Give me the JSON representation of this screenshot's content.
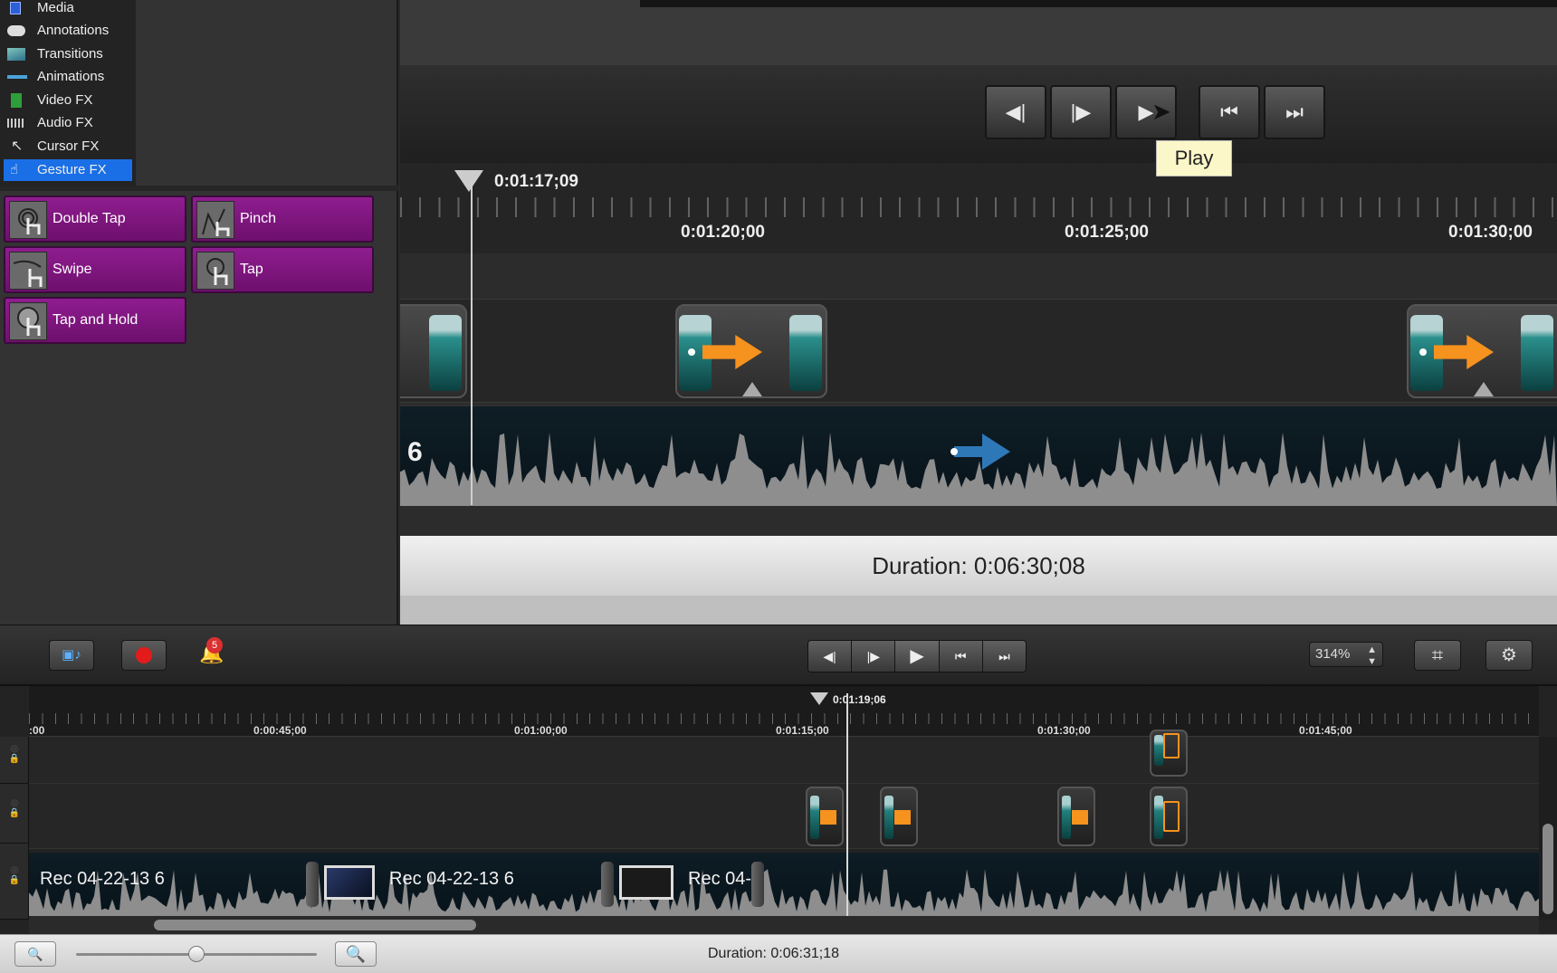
{
  "library": {
    "categories": [
      {
        "label": "Media",
        "icon": "media-icon"
      },
      {
        "label": "Annotations",
        "icon": "annotations-icon"
      },
      {
        "label": "Transitions",
        "icon": "transitions-icon"
      },
      {
        "label": "Animations",
        "icon": "animations-icon"
      },
      {
        "label": "Video FX",
        "icon": "video-fx-icon"
      },
      {
        "label": "Audio FX",
        "icon": "audio-fx-icon"
      },
      {
        "label": "Cursor FX",
        "icon": "cursor-fx-icon"
      },
      {
        "label": "Gesture FX",
        "icon": "gesture-fx-icon",
        "selected": true
      }
    ],
    "gestures": [
      {
        "label": "Double Tap"
      },
      {
        "label": "Pinch"
      },
      {
        "label": "Swipe"
      },
      {
        "label": "Tap"
      },
      {
        "label": "Tap and Hold"
      }
    ]
  },
  "zoom_view": {
    "playhead_time": "0:01:17;09",
    "ruler_times": [
      "0:01:20;00",
      "0:01:25;00",
      "0:01:30;00"
    ],
    "tooltip": "Play",
    "track_number": "6",
    "duration": "Duration: 0:06:30;08"
  },
  "toolbar": {
    "notification_count": "5",
    "zoom_value": "314%"
  },
  "timeline": {
    "playhead_time": "0:01:19;06",
    "ruler_times": [
      ":00",
      "0:00:45;00",
      "0:01:00;00",
      "0:01:15;00",
      "0:01:30;00",
      "0:01:45;00"
    ],
    "clip_labels": [
      "Rec 04-22-13 6",
      "Rec 04-22-13 6",
      "Rec 04-:"
    ]
  },
  "status": {
    "duration": "Duration: 0:06:31;18"
  },
  "colors": {
    "gesture_purple": "#7a137a",
    "selection_blue": "#1a6fe6",
    "arrow_orange": "#f6921e",
    "record_red": "#e31b1b"
  }
}
